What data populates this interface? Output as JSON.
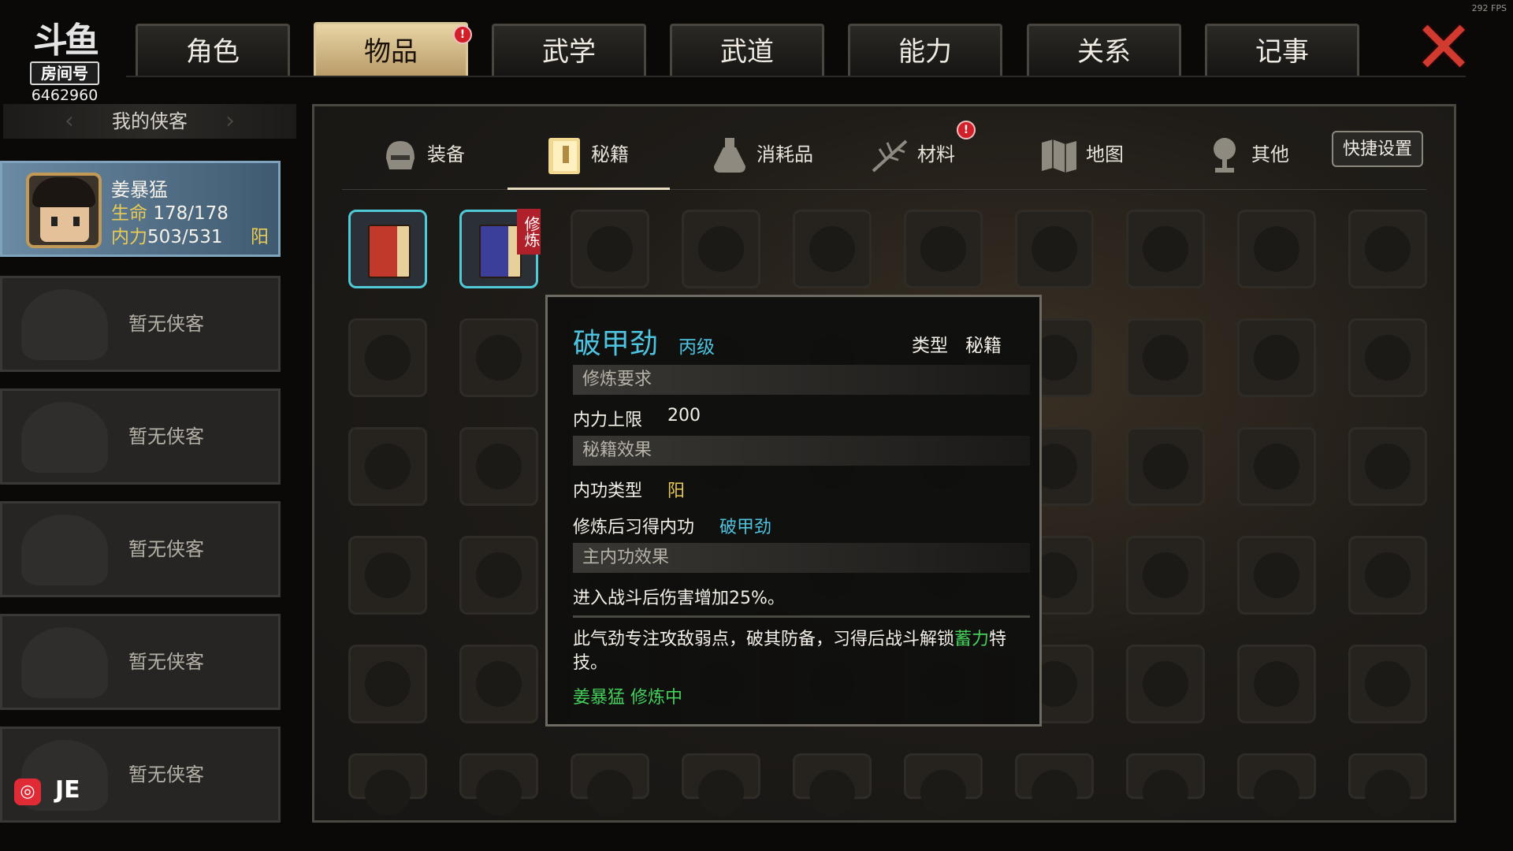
{
  "fps": "292 FPS",
  "logo": {
    "title": "斗鱼",
    "room_label": "房间号",
    "room_number": "6462960"
  },
  "main_tabs": [
    {
      "label": "角色"
    },
    {
      "label": "物品"
    },
    {
      "label": "武学"
    },
    {
      "label": "武道"
    },
    {
      "label": "能力"
    },
    {
      "label": "关系"
    },
    {
      "label": "记事"
    }
  ],
  "active_main_tab": "物品",
  "alert_mark": "!",
  "close_glyph": "✕",
  "left_panel": {
    "header": "我的侠客",
    "hero": {
      "name": "姜暴猛",
      "hp_label": "生命",
      "hp_value": "178/178",
      "mp_label": "内力",
      "mp_value": "503/531",
      "attribute": "阳"
    },
    "empty_slot_label": "暂无侠客",
    "empty_slots": 5
  },
  "bottom": {
    "text": "JE"
  },
  "sub_tabs": [
    {
      "label": "装备",
      "icon": "helmet-icon"
    },
    {
      "label": "秘籍",
      "icon": "book-icon"
    },
    {
      "label": "消耗品",
      "icon": "potion-icon"
    },
    {
      "label": "材料",
      "icon": "herb-icon"
    },
    {
      "label": "地图",
      "icon": "map-icon"
    },
    {
      "label": "其他",
      "icon": "trophy-icon"
    }
  ],
  "active_sub_tab": "秘籍",
  "quick_settings_label": "快捷设置",
  "inventory": {
    "items": [
      {
        "name": "book-red",
        "color": "#c0392b"
      },
      {
        "name": "book-blue",
        "color": "#3b3f9a",
        "badge": "修炼"
      }
    ]
  },
  "tooltip": {
    "title": "破甲劲",
    "grade": "丙级",
    "type_label": "类型",
    "type_value": "秘籍",
    "section_requirement": "修炼要求",
    "req_label": "内力上限",
    "req_value": "200",
    "section_effect": "秘籍效果",
    "neigong_type_label": "内功类型",
    "neigong_type_value": "阳",
    "learned_label": "修炼后习得内功",
    "learned_value": "破甲劲",
    "section_main_effect": "主内功效果",
    "main_effect_text": "进入战斗后伤害增加25%。",
    "desc_part1": "此气劲专注攻敌弱点，破其防备，习得后战斗解锁",
    "desc_highlight": "蓄力",
    "desc_part2": "特技。",
    "status": "姜暴猛 修炼中"
  },
  "colors": {
    "accent_cyan": "#4ec3e0",
    "accent_yellow": "#eacb55",
    "accent_green": "#44d05a",
    "alert_red": "#d2202a"
  }
}
